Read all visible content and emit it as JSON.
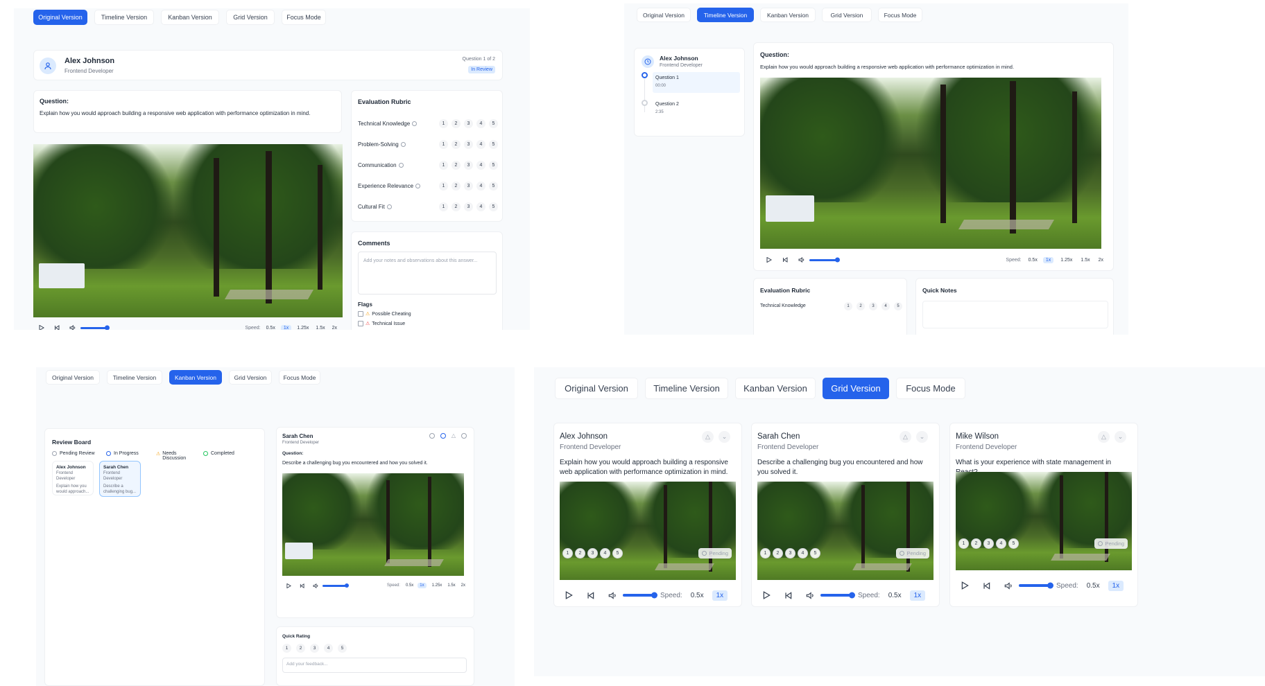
{
  "tabs": [
    "Original Version",
    "Timeline Version",
    "Kanban Version",
    "Grid Version",
    "Focus Mode"
  ],
  "candidate": {
    "name": "Alex Johnson",
    "role": "Frontend Developer"
  },
  "question_counter": "Question 1 of 2",
  "status": "In Review",
  "question_label": "Question:",
  "question_text": "Explain how you would approach building a responsive web application with performance optimization in mind.",
  "rubric": {
    "title": "Evaluation Rubric",
    "criteria": [
      "Technical Knowledge",
      "Problem-Solving",
      "Communication",
      "Experience Relevance",
      "Cultural Fit"
    ],
    "scores": [
      "1",
      "2",
      "3",
      "4",
      "5"
    ]
  },
  "comments": {
    "title": "Comments",
    "placeholder": "Add your notes and observations about this answer..."
  },
  "flags": {
    "title": "Flags",
    "items": [
      "Possible Cheating",
      "Technical Issue"
    ]
  },
  "player": {
    "speed_label": "Speed:",
    "speeds": [
      "0.5x",
      "1x",
      "1.25x",
      "1.5x",
      "2x"
    ],
    "volume_level": 0.8
  },
  "timeline": {
    "items": [
      {
        "title": "Question 1",
        "time": "00:00"
      },
      {
        "title": "Question 2",
        "time": "2:35"
      }
    ],
    "quick_notes": "Quick Notes",
    "rubric_partial": "Technical Knowledge"
  },
  "kanban": {
    "board_title": "Review Board",
    "columns": [
      "Pending Review",
      "In Progress",
      "Needs Discussion",
      "Completed"
    ],
    "cards": [
      {
        "name": "Alex Johnson",
        "role": "Frontend Developer",
        "snippet": "Explain how you would approach..."
      },
      {
        "name": "Sarah Chen",
        "role": "Frontend Developer",
        "snippet": "Describe a challenging bug..."
      }
    ],
    "detail": {
      "name": "Sarah Chen",
      "role": "Frontend Developer",
      "question_label": "Question:",
      "question": "Describe a challenging bug you encountered and how you solved it."
    },
    "quick_rating": "Quick Rating",
    "feedback_placeholder": "Add your feedback..."
  },
  "grid": {
    "pending": "Pending",
    "cards": [
      {
        "name": "Alex Johnson",
        "role": "Frontend Developer",
        "question": "Explain how you would approach building a responsive web application with performance optimization in mind."
      },
      {
        "name": "Sarah Chen",
        "role": "Frontend Developer",
        "question": "Describe a challenging bug you encountered and how you solved it."
      },
      {
        "name": "Mike Wilson",
        "role": "Frontend Developer",
        "question": "What is your experience with state management in React?"
      }
    ]
  },
  "colors": {
    "accent": "#2563eb",
    "accent_soft": "#dbeafe",
    "panel_bg": "#f8fafc"
  }
}
